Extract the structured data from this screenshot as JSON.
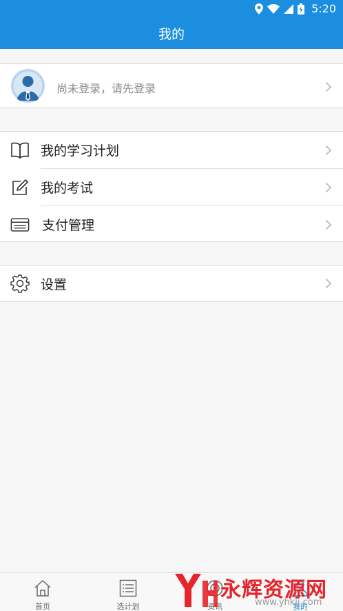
{
  "status_bar": {
    "time": "5:20"
  },
  "header": {
    "title": "我的"
  },
  "profile": {
    "login_prompt": "尚未登录，请先登录"
  },
  "menu_group_1": {
    "items": [
      {
        "label": "我的学习计划",
        "icon": "book-icon"
      },
      {
        "label": "我的考试",
        "icon": "edit-icon"
      },
      {
        "label": "支付管理",
        "icon": "card-icon"
      }
    ]
  },
  "menu_group_2": {
    "items": [
      {
        "label": "设置",
        "icon": "gear-icon"
      }
    ]
  },
  "tab_bar": {
    "tabs": [
      {
        "label": "首页",
        "icon": "home-icon"
      },
      {
        "label": "选计划",
        "icon": "list-icon"
      },
      {
        "label": "资讯",
        "icon": "news-icon"
      },
      {
        "label": "我的",
        "icon": "user-icon",
        "active": true
      }
    ]
  },
  "watermark": {
    "brand": "永辉资源网",
    "url": "www.yhkjj.com"
  },
  "colors": {
    "primary": "#1b8ee0",
    "watermark_red": "#e5242b"
  }
}
